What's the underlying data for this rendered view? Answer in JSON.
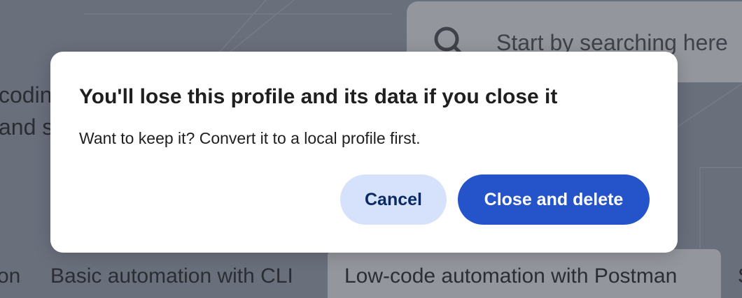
{
  "background": {
    "search": {
      "placeholder": "Start by searching here",
      "icon": "search-icon"
    },
    "text_lines": [
      "coding",
      "and st"
    ],
    "tabs": [
      {
        "label": "on"
      },
      {
        "label": "Basic automation with CLI"
      },
      {
        "label": "Low-code automation with Postman",
        "selected": true
      },
      {
        "label": "S"
      }
    ]
  },
  "dialog": {
    "title": "You'll lose this profile and its data if you close it",
    "body": "Want to keep it? Convert it to a local profile first.",
    "cancel_label": "Cancel",
    "confirm_label": "Close and delete"
  },
  "colors": {
    "primary_button": "#2553c9",
    "secondary_button": "#d6e2fb",
    "scrim": "#6a6f7c"
  }
}
